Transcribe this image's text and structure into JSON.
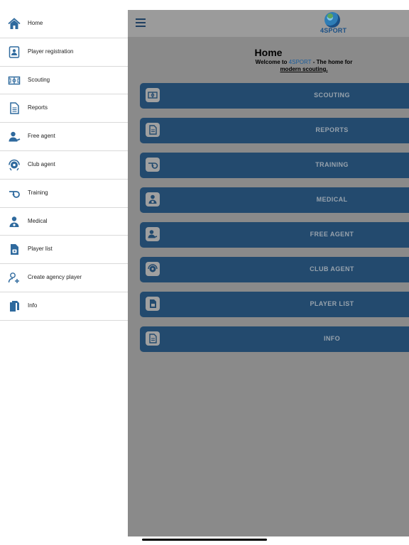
{
  "app": {
    "logo_text": "4SPORT"
  },
  "sidebar": {
    "items": [
      {
        "label": "Home",
        "icon": "home-icon"
      },
      {
        "label": "Player registration",
        "icon": "id-card-icon"
      },
      {
        "label": "Scouting",
        "icon": "field-icon"
      },
      {
        "label": "Reports",
        "icon": "document-icon"
      },
      {
        "label": "Free agent",
        "icon": "user-signature-icon"
      },
      {
        "label": "Club agent",
        "icon": "football-player-icon"
      },
      {
        "label": "Training",
        "icon": "whistle-icon"
      },
      {
        "label": "Medical",
        "icon": "doctor-icon"
      },
      {
        "label": "Player list",
        "icon": "list-document-icon"
      },
      {
        "label": "Create agency player",
        "icon": "user-plus-icon"
      },
      {
        "label": "Info",
        "icon": "info-document-icon"
      }
    ]
  },
  "main": {
    "title": "Home",
    "welcome_prefix": "Welcome to ",
    "welcome_brand": "4SPORT",
    "welcome_suffix": " - The home for",
    "welcome_link": "modern scouting.",
    "sections": [
      {
        "label": "SCOUTING",
        "icon": "field-icon"
      },
      {
        "label": "REPORTS",
        "icon": "document-icon"
      },
      {
        "label": "TRAINING",
        "icon": "whistle-icon"
      },
      {
        "label": "MEDICAL",
        "icon": "doctor-icon"
      },
      {
        "label": "FREE AGENT",
        "icon": "user-signature-icon"
      },
      {
        "label": "CLUB AGENT",
        "icon": "football-player-icon"
      },
      {
        "label": "PLAYER LIST",
        "icon": "list-document-icon"
      },
      {
        "label": "INFO",
        "icon": "info-document-icon"
      }
    ]
  },
  "colors": {
    "accent": "#2f6a9e",
    "button_bg": "#234a6e",
    "overlay": "#8a8a8a"
  }
}
